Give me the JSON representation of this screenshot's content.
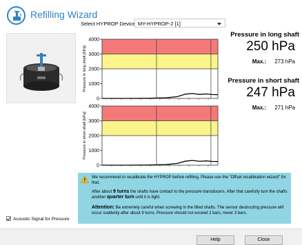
{
  "app": {
    "title": "Refilling Wizard",
    "title_icon": "hyprop-refill-icon"
  },
  "device": {
    "label": "Select HYPROP Device:",
    "selected": "MY-HYPROP-2 [1]"
  },
  "long_shaft": {
    "title": "Pressure in long shaft",
    "value": "250 hPa",
    "max_label": "Max.:",
    "max_value": "273 hPa"
  },
  "short_shaft": {
    "title": "Pressure in short shaft",
    "value": "247 hPa",
    "max_label": "Max.:",
    "max_value": "271 hPa"
  },
  "colors": {
    "accent": "#2f82c4",
    "zone_red": "#f47a7a",
    "zone_yellow": "#fbf48a",
    "info_bg": "#8fd5e3"
  },
  "chart_data": [
    {
      "type": "line",
      "ylabel": "Pressure in long shaft [hPa]",
      "ylim": [
        0,
        4000
      ],
      "yticks": [
        "4000",
        "3000",
        "2000",
        "1000",
        "0"
      ],
      "zones": [
        {
          "from": 3000,
          "to": 4000,
          "color": "#f47a7a"
        },
        {
          "from": 2000,
          "to": 3000,
          "color": "#fbf48a"
        }
      ],
      "xlim": [
        0,
        1
      ],
      "series": [
        {
          "x": [
            0,
            0.2,
            0.4,
            0.55,
            0.65,
            0.72,
            0.78,
            0.84,
            0.9,
            0.95,
            1.0
          ],
          "values": [
            0,
            0,
            10,
            40,
            120,
            290,
            330,
            270,
            300,
            260,
            250
          ]
        }
      ]
    },
    {
      "type": "line",
      "ylabel": "Pressure in short shaft [hPa]",
      "ylim": [
        0,
        4000
      ],
      "yticks": [
        "4000",
        "3000",
        "2000",
        "1000",
        "0"
      ],
      "zones": [
        {
          "from": 3000,
          "to": 4000,
          "color": "#f47a7a"
        },
        {
          "from": 2000,
          "to": 3000,
          "color": "#fbf48a"
        }
      ],
      "xlim": [
        0,
        1
      ],
      "series": [
        {
          "x": [
            0,
            0.2,
            0.4,
            0.55,
            0.65,
            0.72,
            0.78,
            0.84,
            0.9,
            0.95,
            1.0
          ],
          "values": [
            0,
            0,
            10,
            40,
            120,
            270,
            320,
            260,
            290,
            255,
            247
          ]
        }
      ]
    }
  ],
  "info": {
    "p1": "We recommend to recalibrate the HYPROP before refilling. Please use the \"Offset recalibration wizard\" for that.",
    "p2_pre": "After about",
    "p2_turns": "9 turns",
    "p2_mid": "the shafts have contact to the pressure transducers. After that carefully turn the shafts another",
    "p2_quarter": "quarter turn",
    "p2_post": "until it is tight.",
    "p3_label": "Attention:",
    "p3": "Be extremely careful when screwing in the filled shafts. The sensor destructing pressure will occur suddenly after about 9 turns. Pressure should not exceed 2 bars, never 3 bars."
  },
  "acoustic": {
    "label": "Acoustic Signal for Pressure",
    "checked": true
  },
  "buttons": {
    "help": "Help",
    "close": "Close"
  }
}
